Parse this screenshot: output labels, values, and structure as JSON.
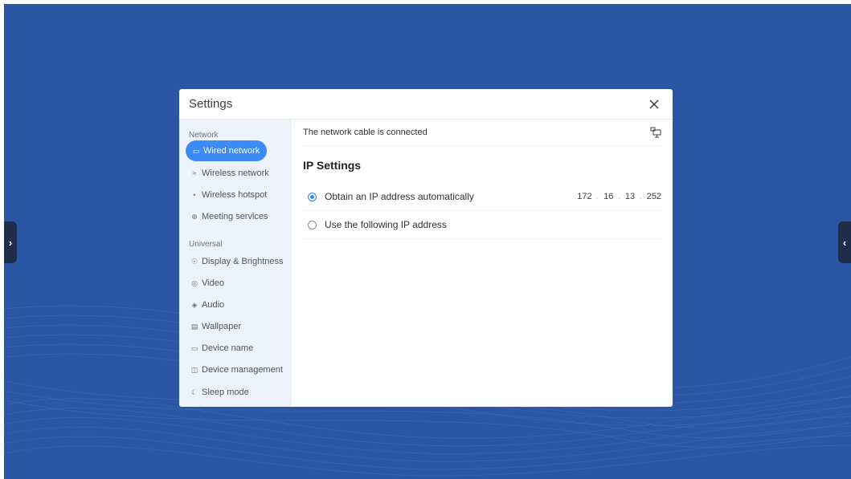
{
  "colors": {
    "background": "#2b56a4",
    "accent": "#3b8af5",
    "sidebar_bg": "#edf2fb"
  },
  "dialog": {
    "title": "Settings",
    "close_icon": "close-icon"
  },
  "sidebar": {
    "network_label": "Network",
    "universal_label": "Universal",
    "items": [
      {
        "label": "Wired network",
        "icon": "monitor-icon",
        "active": true
      },
      {
        "label": "Wireless network",
        "icon": "wifi-icon"
      },
      {
        "label": "Wireless hotspot",
        "icon": "hotspot-icon"
      },
      {
        "label": "Meeting services",
        "icon": "globe-icon"
      },
      {
        "label": "Display & Brightness",
        "icon": "eye-icon"
      },
      {
        "label": "Video",
        "icon": "video-icon"
      },
      {
        "label": "Audio",
        "icon": "audio-icon"
      },
      {
        "label": "Wallpaper",
        "icon": "wallpaper-icon"
      },
      {
        "label": "Device name",
        "icon": "device-icon"
      },
      {
        "label": "Device management",
        "icon": "device-management-icon"
      },
      {
        "label": "Sleep mode",
        "icon": "sleep-icon"
      }
    ]
  },
  "content": {
    "status_text": "The network cable is connected",
    "status_icon": "ethernet-icon",
    "section_title": "IP Settings",
    "options": [
      {
        "label": "Obtain an IP address automatically",
        "selected": true
      },
      {
        "label": "Use the following IP address",
        "selected": false
      }
    ],
    "ip": [
      "172",
      "16",
      "13",
      "252"
    ]
  }
}
